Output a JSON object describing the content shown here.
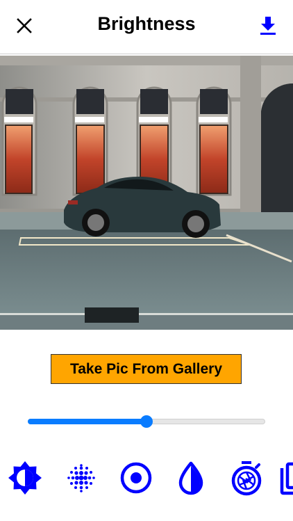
{
  "header": {
    "title": "Brightness",
    "close_icon": "close-icon",
    "download_icon": "download-icon"
  },
  "actions": {
    "gallery_button_label": "Take Pic From Gallery"
  },
  "slider": {
    "value_percent": 50
  },
  "toolbar": {
    "tools": [
      "brightness-icon",
      "blur-dots-icon",
      "radio-target-icon",
      "contrast-drop-icon",
      "shutter-timer-icon",
      "copy-icon"
    ]
  },
  "colors": {
    "accent": "#0000ff",
    "slider": "#0a7cff",
    "button_bg": "#ffa500"
  }
}
